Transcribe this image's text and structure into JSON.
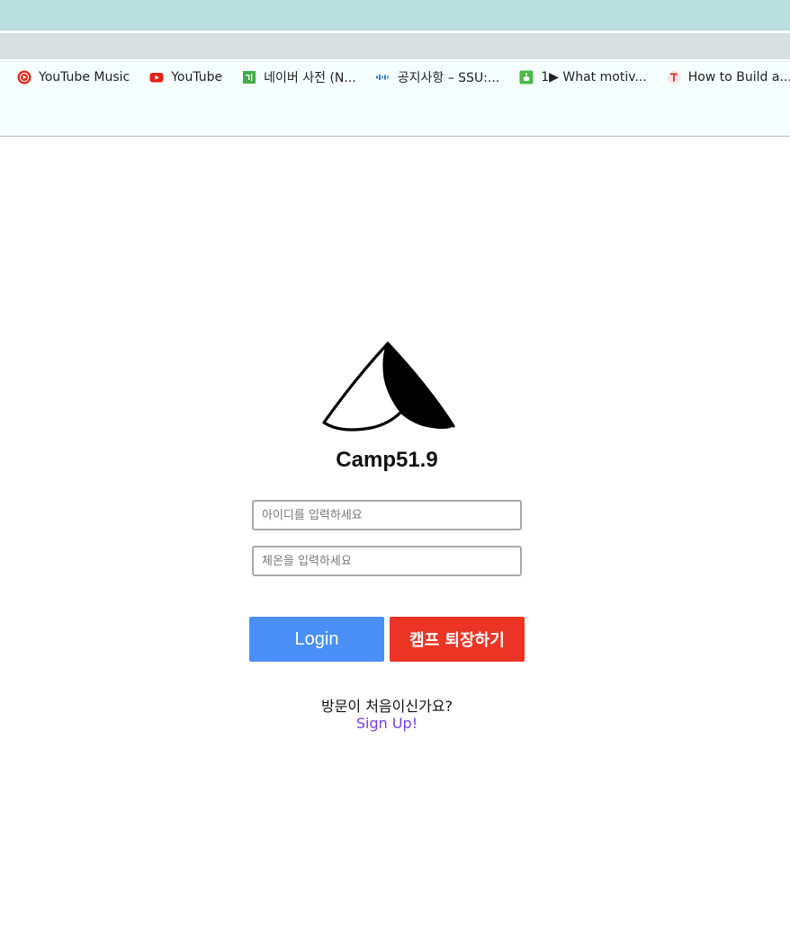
{
  "browser": {
    "bookmarks": [
      {
        "label": "YouTube Music",
        "icon": "youtube-music-icon"
      },
      {
        "label": "YouTube",
        "icon": "youtube-icon"
      },
      {
        "label": "네이버 사전 (N...",
        "icon": "naver-dictionary-icon"
      },
      {
        "label": "공지사항 – SSU:...",
        "icon": "ssu-icon"
      },
      {
        "label": "1▶ What motiv...",
        "icon": "green-app-icon"
      },
      {
        "label": "How to Build a...",
        "icon": "red-t-icon"
      }
    ]
  },
  "login": {
    "brand_name": "Camp51.9",
    "id_placeholder": "아이디를 입력하세요",
    "pw_placeholder": "체온을 입력하세요",
    "login_label": "Login",
    "leave_label": "캠프 퇴장하기",
    "signup_question": "방문이 처음이신가요?",
    "signup_link": "Sign Up!"
  },
  "colors": {
    "login_button": "#4a8ff7",
    "leave_button": "#ec3425",
    "signup_link": "#7b3fe0"
  }
}
